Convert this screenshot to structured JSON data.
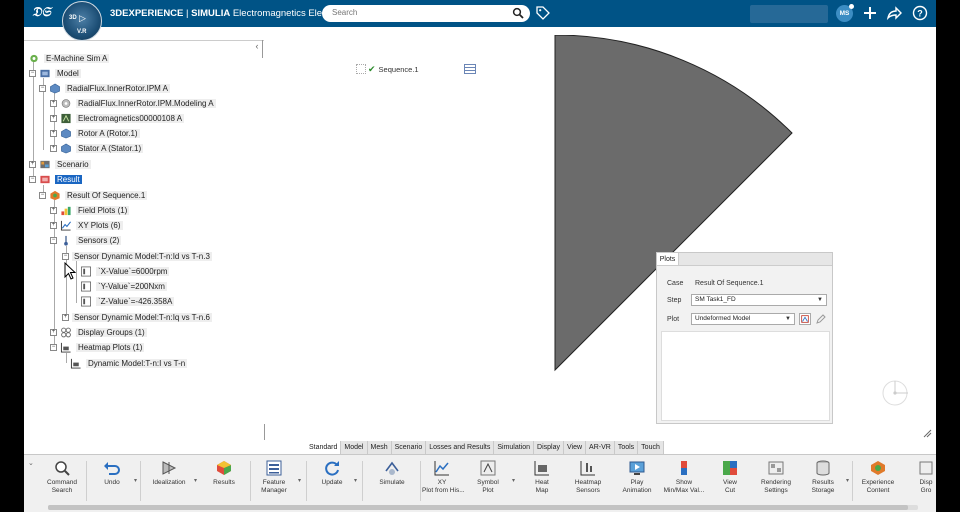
{
  "topbar": {
    "brand": "3DEXPERIENCE",
    "separator": " | ",
    "product": "SIMULIA",
    "app_name": "Electromagnetics Electric...",
    "compass_top": "3D",
    "compass_bottom": "V.R",
    "search_placeholder": "Search",
    "user_initials": "MS",
    "icons": [
      "tag-icon",
      "add-icon",
      "share-icon",
      "help-icon"
    ]
  },
  "tree": {
    "root": "E-Machine Sim A",
    "items": [
      {
        "label": "Model"
      },
      {
        "label": "RadialFlux.InnerRotor.IPM A"
      },
      {
        "label": "RadialFlux.InnerRotor.IPM.Modeling A"
      },
      {
        "label": "Electromagnetics00000108 A"
      },
      {
        "label": "Rotor A (Rotor.1)"
      },
      {
        "label": "Stator A (Stator.1)"
      },
      {
        "label": "Scenario"
      },
      {
        "label": "Result"
      },
      {
        "label": "Result Of Sequence.1"
      },
      {
        "label": "Field Plots (1)"
      },
      {
        "label": "XY Plots (6)"
      },
      {
        "label": "Sensors (2)"
      },
      {
        "label": "Sensor Dynamic Model:T-n:Id vs T-n.3"
      },
      {
        "label": "`X-Value`=6000rpm"
      },
      {
        "label": "`Y-Value`=200Nxm"
      },
      {
        "label": "`Z-Value`=-426.358A"
      },
      {
        "label": "Sensor Dynamic Model:T-n:Iq vs T-n.6"
      },
      {
        "label": "Display Groups (1)"
      },
      {
        "label": "Heatmap Plots (1)"
      },
      {
        "label": "Dynamic Model:T-n:I vs T-n"
      }
    ]
  },
  "viewer": {
    "sequence_label": "Sequence.1"
  },
  "plots_panel": {
    "tab": "Plots",
    "case_label": "Case",
    "case_value": "Result Of Sequence.1",
    "step_label": "Step",
    "step_value": "SM Task1_FD",
    "plot_label": "Plot",
    "plot_value": "Undeformed Model"
  },
  "command_tabs": [
    "Standard",
    "Model",
    "Mesh",
    "Scenario",
    "Losses and Results",
    "Simulation",
    "Display",
    "View",
    "AR-VR",
    "Tools",
    "Touch"
  ],
  "active_tab": "Standard",
  "actions": [
    {
      "line1": "Command",
      "line2": "Search",
      "icon": "command-search-icon"
    },
    {
      "line1": "Undo",
      "line2": "",
      "icon": "undo-icon"
    },
    {
      "line1": "Idealization",
      "line2": "",
      "icon": "idealization-icon"
    },
    {
      "line1": "Results",
      "line2": "",
      "icon": "results-icon"
    },
    {
      "line1": "Feature",
      "line2": "Manager",
      "icon": "feature-manager-icon"
    },
    {
      "line1": "Update",
      "line2": "",
      "icon": "update-icon"
    },
    {
      "line1": "Simulate",
      "line2": "",
      "icon": "simulate-icon"
    },
    {
      "line1": "XY",
      "line2": "Plot from His...",
      "icon": "xy-plot-icon"
    },
    {
      "line1": "Symbol",
      "line2": "Plot",
      "icon": "symbol-plot-icon"
    },
    {
      "line1": "Heat",
      "line2": "Map",
      "icon": "heat-map-icon"
    },
    {
      "line1": "Heatmap",
      "line2": "Sensors",
      "icon": "heatmap-sensors-icon"
    },
    {
      "line1": "Play",
      "line2": "Animation",
      "icon": "play-animation-icon"
    },
    {
      "line1": "Show",
      "line2": "Min/Max Val...",
      "icon": "show-minmax-icon"
    },
    {
      "line1": "View",
      "line2": "Cut",
      "icon": "view-cut-icon"
    },
    {
      "line1": "Rendering",
      "line2": "Settings",
      "icon": "rendering-settings-icon"
    },
    {
      "line1": "Results",
      "line2": "Storage",
      "icon": "results-storage-icon"
    },
    {
      "line1": "Experience",
      "line2": "Content",
      "icon": "experience-content-icon"
    },
    {
      "line1": "Disp",
      "line2": "Gro",
      "icon": "display-group-icon"
    }
  ],
  "colors": {
    "topbar": "#005386",
    "selection": "#1a66c2",
    "geometry": "#666666"
  }
}
